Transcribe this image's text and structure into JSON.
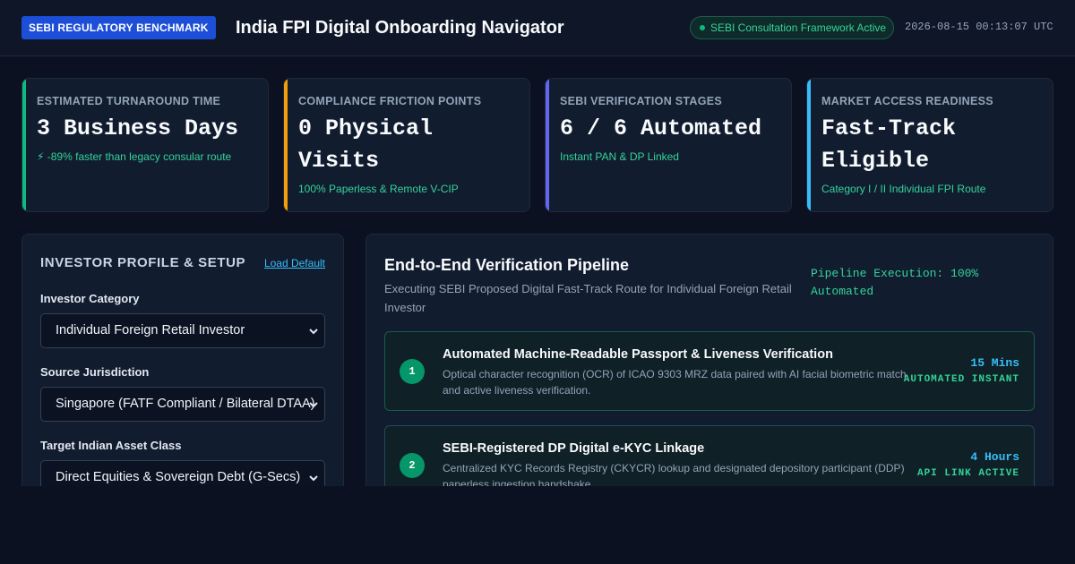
{
  "header": {
    "badge": "SEBI REGULATORY BENCHMARK",
    "title": "India FPI Digital Onboarding Navigator",
    "status": "SEBI Consultation Framework Active",
    "timestamp": "2026-08-15 00:13:07 UTC"
  },
  "kpis": [
    {
      "label": "Estimated Turnaround Time",
      "value": "3 Business Days",
      "sub": "⚡ -89% faster than legacy consular route",
      "accent": "#10b981"
    },
    {
      "label": "Compliance Friction Points",
      "value": "0 Physical Visits",
      "sub": "100% Paperless & Remote V-CIP",
      "accent": "#f59e0b"
    },
    {
      "label": "SEBI Verification Stages",
      "value": "6 / 6 Automated",
      "sub": "Instant PAN & DP Linked",
      "accent": "#6366f1"
    },
    {
      "label": "Market Access Readiness",
      "value": "Fast-Track Eligible",
      "sub": "Category I / II Individual FPI Route",
      "accent": "#38bdf8"
    }
  ],
  "profile": {
    "heading": "INVESTOR PROFILE & SETUP",
    "load_default": "Load Default",
    "fields": [
      {
        "label": "Investor Category",
        "value": "Individual Foreign Retail Investor"
      },
      {
        "label": "Source Jurisdiction",
        "value": "Singapore (FATF Compliant / Bilateral DTAA)"
      },
      {
        "label": "Target Indian Asset Class",
        "value": "Direct Equities & Sovereign Debt (G-Secs)"
      }
    ]
  },
  "pipeline": {
    "title": "End-to-End Verification Pipeline",
    "subtitle": "Executing SEBI Proposed Digital Fast-Track Route for Individual Foreign Retail Investor",
    "execution": "Pipeline Execution: 100% Automated",
    "steps": [
      {
        "num": "1",
        "title": "Automated Machine-Readable Passport & Liveness Verification",
        "desc": "Optical character recognition (OCR) of ICAO 9303 MRZ data paired with AI facial biometric match and active liveness verification.",
        "time": "15 Mins",
        "status": "AUTOMATED INSTANT"
      },
      {
        "num": "2",
        "title": "SEBI-Registered DP Digital e-KYC Linkage",
        "desc": "Centralized KYC Records Registry (CKYCR) lookup and designated depository participant (DDP) paperless ingestion handshake.",
        "time": "4 Hours",
        "status": "API LINK ACTIVE"
      }
    ]
  }
}
